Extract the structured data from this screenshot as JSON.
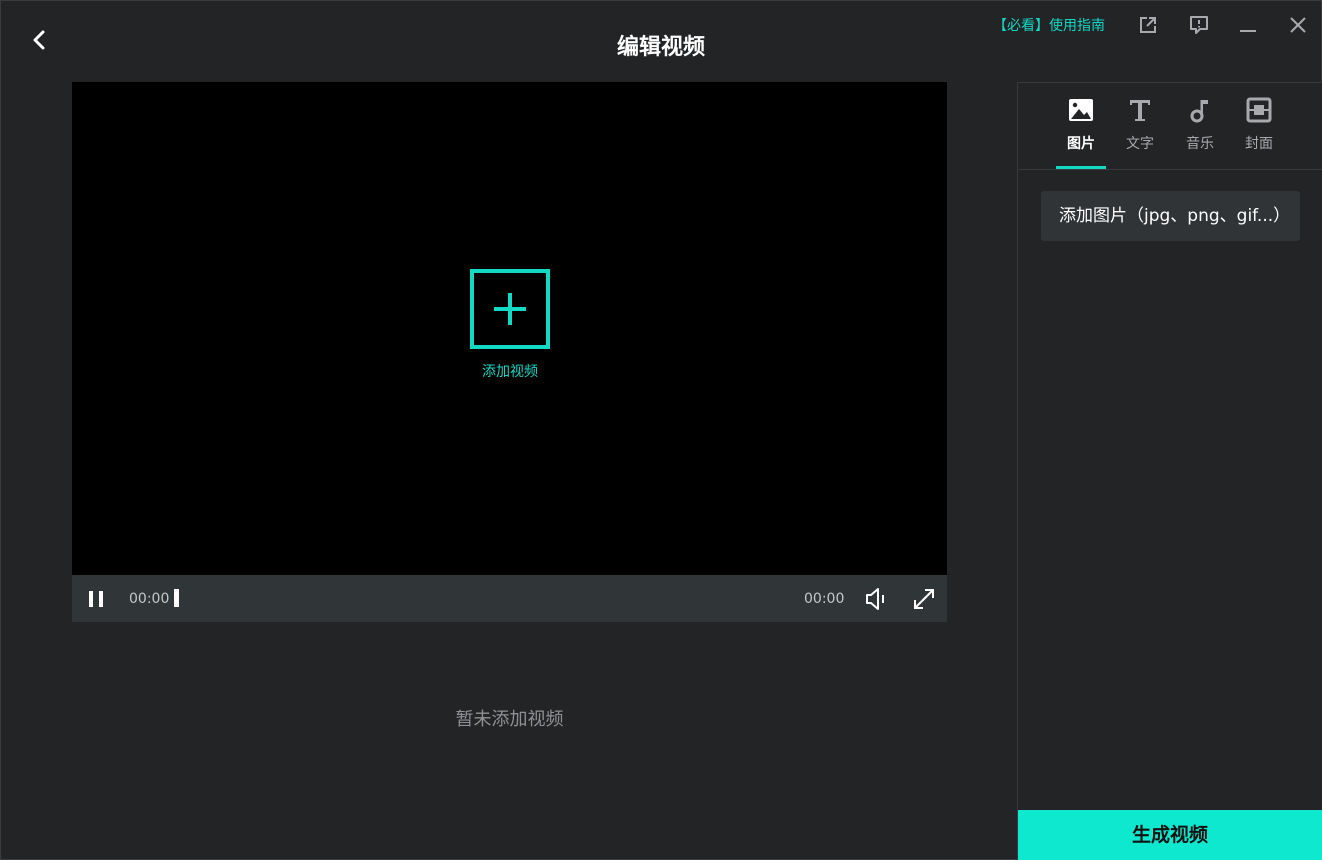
{
  "header": {
    "title": "编辑视频",
    "guide_link": "【必看】使用指南"
  },
  "player": {
    "add_video_label": "添加视频",
    "current_time": "00:00",
    "total_time": "00:00",
    "empty_hint": "暂未添加视频"
  },
  "side_panel": {
    "tabs": [
      {
        "label": "图片",
        "icon": "image-icon",
        "active": true
      },
      {
        "label": "文字",
        "icon": "text-icon",
        "active": false
      },
      {
        "label": "音乐",
        "icon": "music-note-icon",
        "active": false
      },
      {
        "label": "封面",
        "icon": "cover-icon",
        "active": false
      }
    ],
    "add_image_label": "添加图片（jpg、png、gif...）"
  },
  "footer": {
    "generate_label": "生成视频"
  },
  "colors": {
    "accent": "#12d9c4",
    "generate_button": "#0ee8cf",
    "background": "#232426",
    "video_background": "#000000",
    "control_bar": "#303538"
  }
}
